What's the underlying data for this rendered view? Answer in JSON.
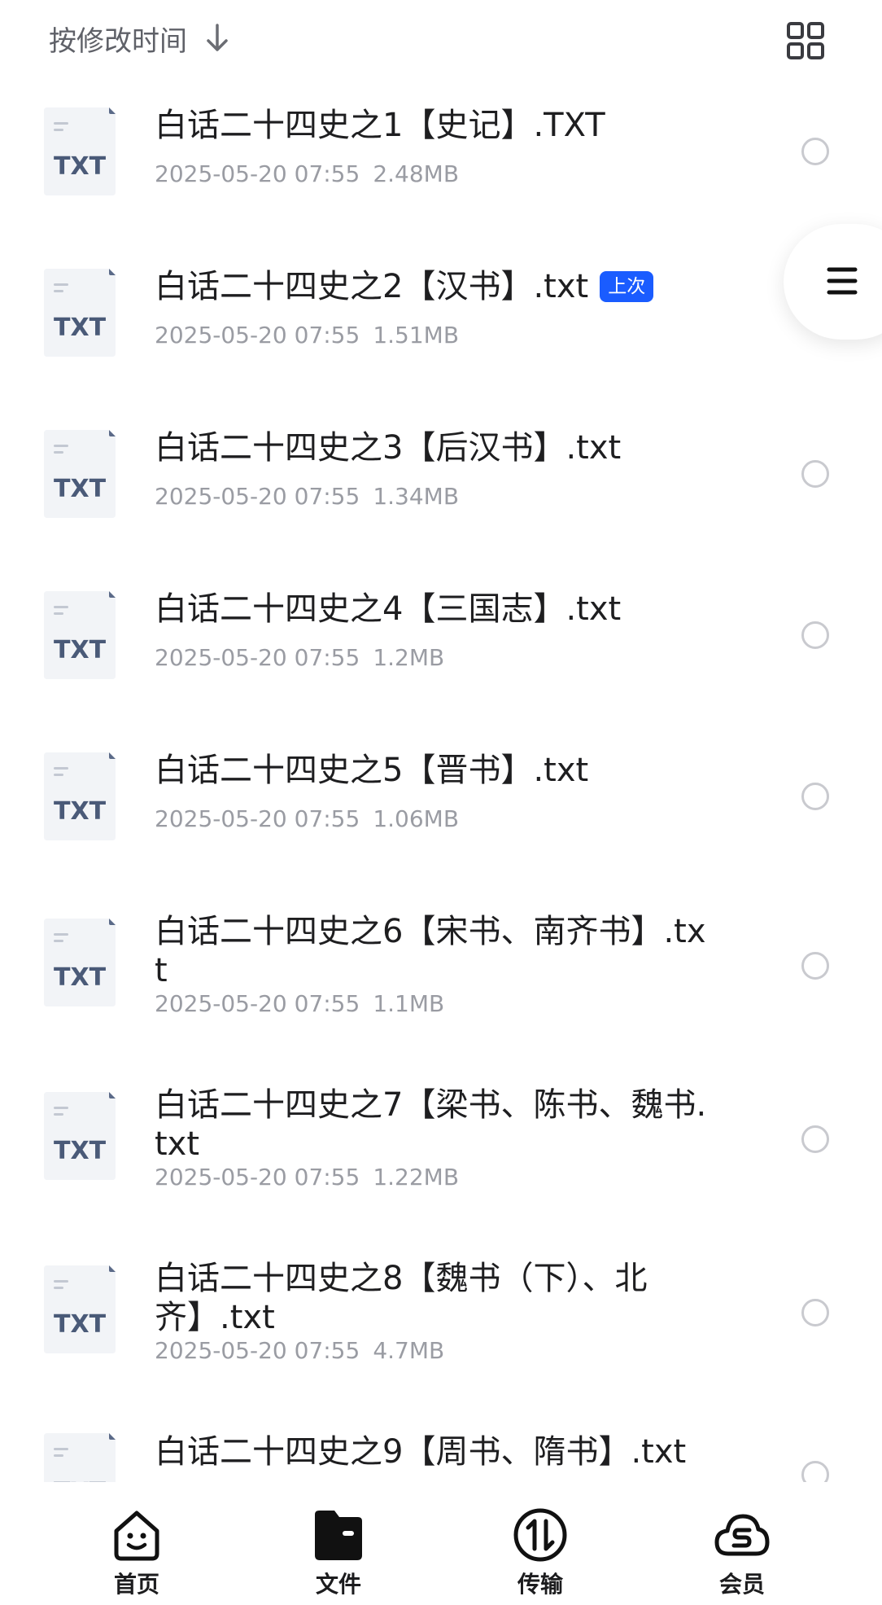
{
  "header": {
    "sort_label": "按修改时间",
    "sort_icon": "arrow-down-icon",
    "view_icon": "grid-view-icon"
  },
  "files": [
    {
      "name": "白话二十四史之1【史记】.TXT",
      "date": "2025-05-20 07:55",
      "size": "2.48MB",
      "icon_text": "TXT",
      "badge": ""
    },
    {
      "name": "白话二十四史之2【汉书】.txt",
      "date": "2025-05-20 07:55",
      "size": "1.51MB",
      "icon_text": "TXT",
      "badge": "上次"
    },
    {
      "name": "白话二十四史之3【后汉书】.txt",
      "date": "2025-05-20 07:55",
      "size": "1.34MB",
      "icon_text": "TXT",
      "badge": ""
    },
    {
      "name": "白话二十四史之4【三国志】.txt",
      "date": "2025-05-20 07:55",
      "size": "1.2MB",
      "icon_text": "TXT",
      "badge": ""
    },
    {
      "name": "白话二十四史之5【晋书】.txt",
      "date": "2025-05-20 07:55",
      "size": "1.06MB",
      "icon_text": "TXT",
      "badge": ""
    },
    {
      "name": "白话二十四史之6【宋书、南齐书】.txt",
      "date": "2025-05-20 07:55",
      "size": "1.1MB",
      "icon_text": "TXT",
      "badge": ""
    },
    {
      "name": "白话二十四史之7【梁书、陈书、魏书.txt",
      "date": "2025-05-20 07:55",
      "size": "1.22MB",
      "icon_text": "TXT",
      "badge": ""
    },
    {
      "name": "白话二十四史之8【魏书（下）、北齐】.txt",
      "date": "2025-05-20 07:55",
      "size": "4.7MB",
      "icon_text": "TXT",
      "badge": ""
    },
    {
      "name": "白话二十四史之9【周书、隋书】.txt",
      "date": "",
      "size": "",
      "icon_text": "TXT",
      "badge": ""
    }
  ],
  "side_menu": {
    "icon": "menu-icon"
  },
  "bottom_nav": [
    {
      "label": "首页",
      "icon": "home-smile-icon"
    },
    {
      "label": "文件",
      "icon": "folder-icon"
    },
    {
      "label": "传输",
      "icon": "transfer-icon"
    },
    {
      "label": "会员",
      "icon": "cloud-member-icon"
    }
  ],
  "colors": {
    "accent": "#1a5cff",
    "text_primary": "#1e1e20",
    "text_secondary": "#9a9ca3",
    "icon_text": "#4a5a78"
  }
}
